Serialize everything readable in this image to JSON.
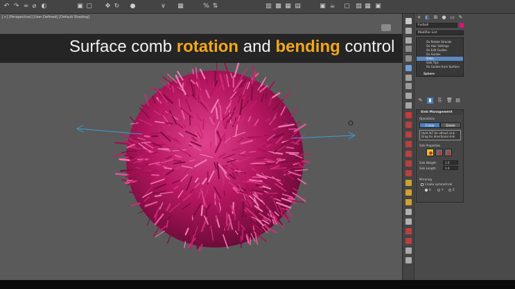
{
  "viewport": {
    "label": "[+] [Perspective] [User Defined] [Default Shading]"
  },
  "banner": {
    "part1": "Surface comb ",
    "part2": "rotation",
    "part3": " and ",
    "part4": "bending",
    "part5": " control",
    "accent_color": "#f4a71d"
  },
  "object": {
    "name": "Furball",
    "swatch_color": "#e0107a"
  },
  "modifier_list": {
    "label": "Modifier List",
    "items": [
      {
        "label": "Ox Rotate Strands",
        "selected": false
      },
      {
        "label": "Ox Hair Settings",
        "selected": false
      },
      {
        "label": "Ox Edit Guides",
        "selected": false
      },
      {
        "label": "Ox Guides",
        "selected": false
      },
      {
        "label": "Sinks",
        "selected": true
      },
      {
        "label": "Sink Tips",
        "selected": false
      },
      {
        "label": "Ox Guides from Surface",
        "selected": false
      }
    ],
    "base": "Sphere"
  },
  "sink_panel": {
    "title": "Sink Management",
    "operations_label": "Operations",
    "create_label": "Create",
    "delete_label": "Delete",
    "hint": "Hold ALT for attract sink - Drag for directional sink",
    "properties_label": "Sink Properties",
    "weight_label": "Sink Weight:",
    "weight_value": "1.0",
    "length_label": "Sink Length:",
    "length_value": "1.0",
    "mirroring_label": "Mirroring",
    "create_symmetrical": "Create symmetrical",
    "axes": [
      "X",
      "Y",
      "Z"
    ]
  },
  "colors": {
    "fur": "#c21a6a",
    "selection": "#5b88c2",
    "button_blue": "#4a7fc0"
  }
}
